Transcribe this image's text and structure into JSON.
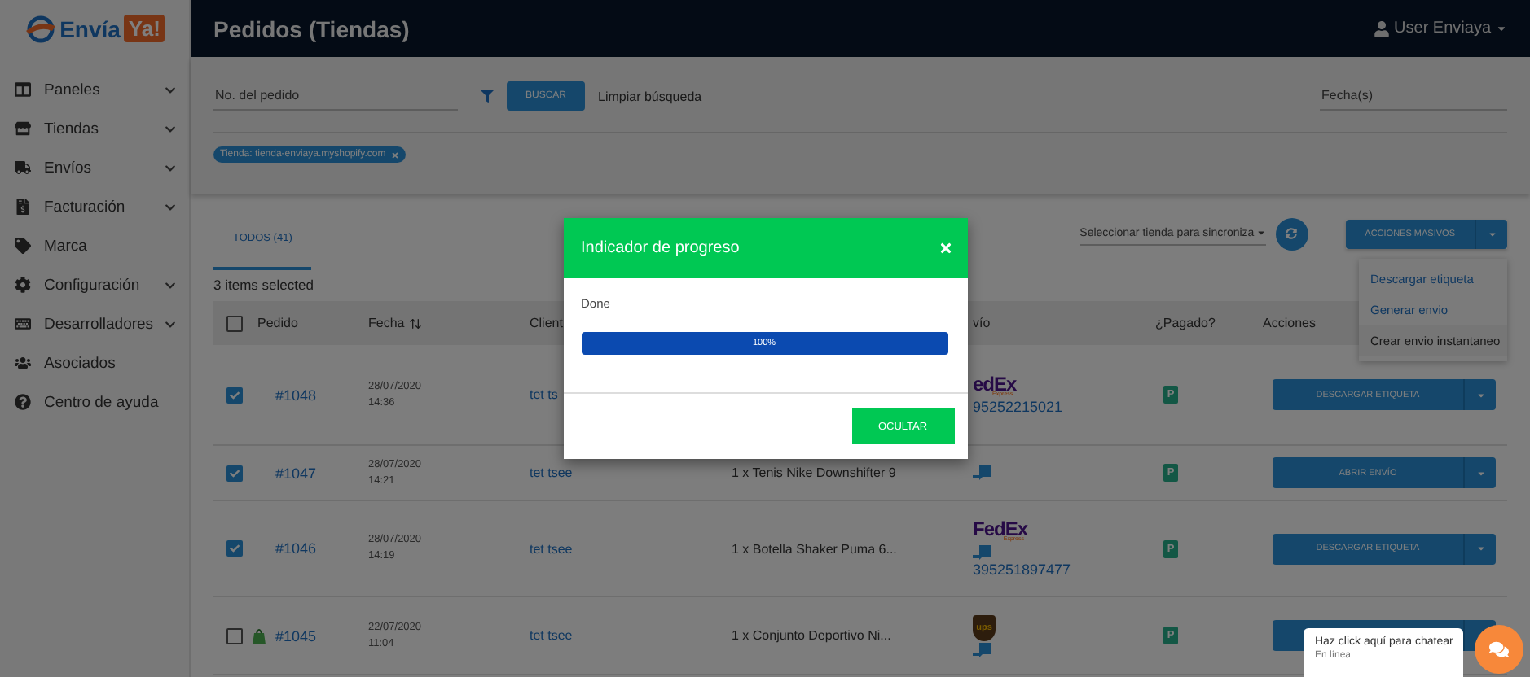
{
  "brand": {
    "first": "Envía",
    "second": "Ya!"
  },
  "sidebar": {
    "items": [
      {
        "label": "Paneles",
        "expandable": true
      },
      {
        "label": "Tiendas",
        "expandable": true
      },
      {
        "label": "Envíos",
        "expandable": true
      },
      {
        "label": "Facturación",
        "expandable": true
      },
      {
        "label": "Marca",
        "expandable": false
      },
      {
        "label": "Configuración",
        "expandable": true
      },
      {
        "label": "Desarrolladores",
        "expandable": true
      },
      {
        "label": "Asociados",
        "expandable": false
      },
      {
        "label": "Centro de ayuda",
        "expandable": false
      }
    ]
  },
  "header": {
    "title": "Pedidos (Tiendas)",
    "user": "User Enviaya"
  },
  "filters": {
    "order_field": {
      "placeholder": "No. del pedido"
    },
    "search_button": "BUSCAR",
    "clear_link": "Limpiar búsqueda",
    "date_field": {
      "placeholder": "Fecha(s)"
    },
    "chips": [
      {
        "label": "Tienda: tienda-enviaya.myshopify.com"
      }
    ]
  },
  "tabs": [
    {
      "label": "TODOS (41)",
      "selected": true
    }
  ],
  "sync_select": {
    "placeholder": "Seleccionar tienda para sincroniza"
  },
  "bulk_button": {
    "label": "ACCIONES MASIVOS"
  },
  "bulk_menu": {
    "items": [
      {
        "label": "Descargar etiqueta",
        "selected": false
      },
      {
        "label": "Generar envio",
        "selected": false
      },
      {
        "label": "Crear envio instantaneo",
        "selected": true
      }
    ]
  },
  "selection_count": "3 items selected",
  "table": {
    "all_checked": false,
    "columns": [
      {
        "label": "Pedido"
      },
      {
        "label": "Fecha",
        "sortable": true
      },
      {
        "label": "Client"
      },
      {
        "label": "vío"
      },
      {
        "label": "¿Pagado?"
      },
      {
        "label": "Acciones"
      }
    ],
    "rows": [
      {
        "checked": true,
        "shopify": false,
        "order": "#1048",
        "date": "28/07/2020",
        "time": "14:36",
        "client": "tet ts",
        "carrier": {
          "kind": "fedex",
          "name": "edEx",
          "sub": "Express"
        },
        "package": false,
        "tracking": "95252215021",
        "paid": "P",
        "action": "DESCARGAR ETIQUETA"
      },
      {
        "checked": true,
        "shopify": false,
        "order": "#1047",
        "date": "28/07/2020",
        "time": "14:21",
        "client": "tet tsee",
        "product": "1 x Tenis Nike Downshifter 9",
        "package": true,
        "paid": "P",
        "action": "ABRIR ENVÍO"
      },
      {
        "checked": true,
        "shopify": false,
        "order": "#1046",
        "date": "28/07/2020",
        "time": "14:19",
        "client": "tet tsee",
        "product": "1 x Botella Shaker Puma 6...",
        "carrier": {
          "kind": "fedex",
          "name": "FedEx",
          "sub": "Express"
        },
        "package": true,
        "tracking": "395251897477",
        "paid": "P",
        "action": "DESCARGAR ETIQUETA"
      },
      {
        "checked": false,
        "shopify": true,
        "order": "#1045",
        "date": "22/07/2020",
        "time": "11:04",
        "client": "tet tsee",
        "product": "1 x Conjunto Deportivo Ni...",
        "carrier": {
          "kind": "ups",
          "name": "ups"
        },
        "package": true,
        "paid": "P"
      }
    ]
  },
  "modal": {
    "title": "Indicador de progreso",
    "message": "Done",
    "progress": {
      "level": 1,
      "reading": "100%"
    },
    "button": "OCULTAR"
  },
  "chat": {
    "prompt": "Haz click aquí para chatear",
    "status": "En línea"
  }
}
